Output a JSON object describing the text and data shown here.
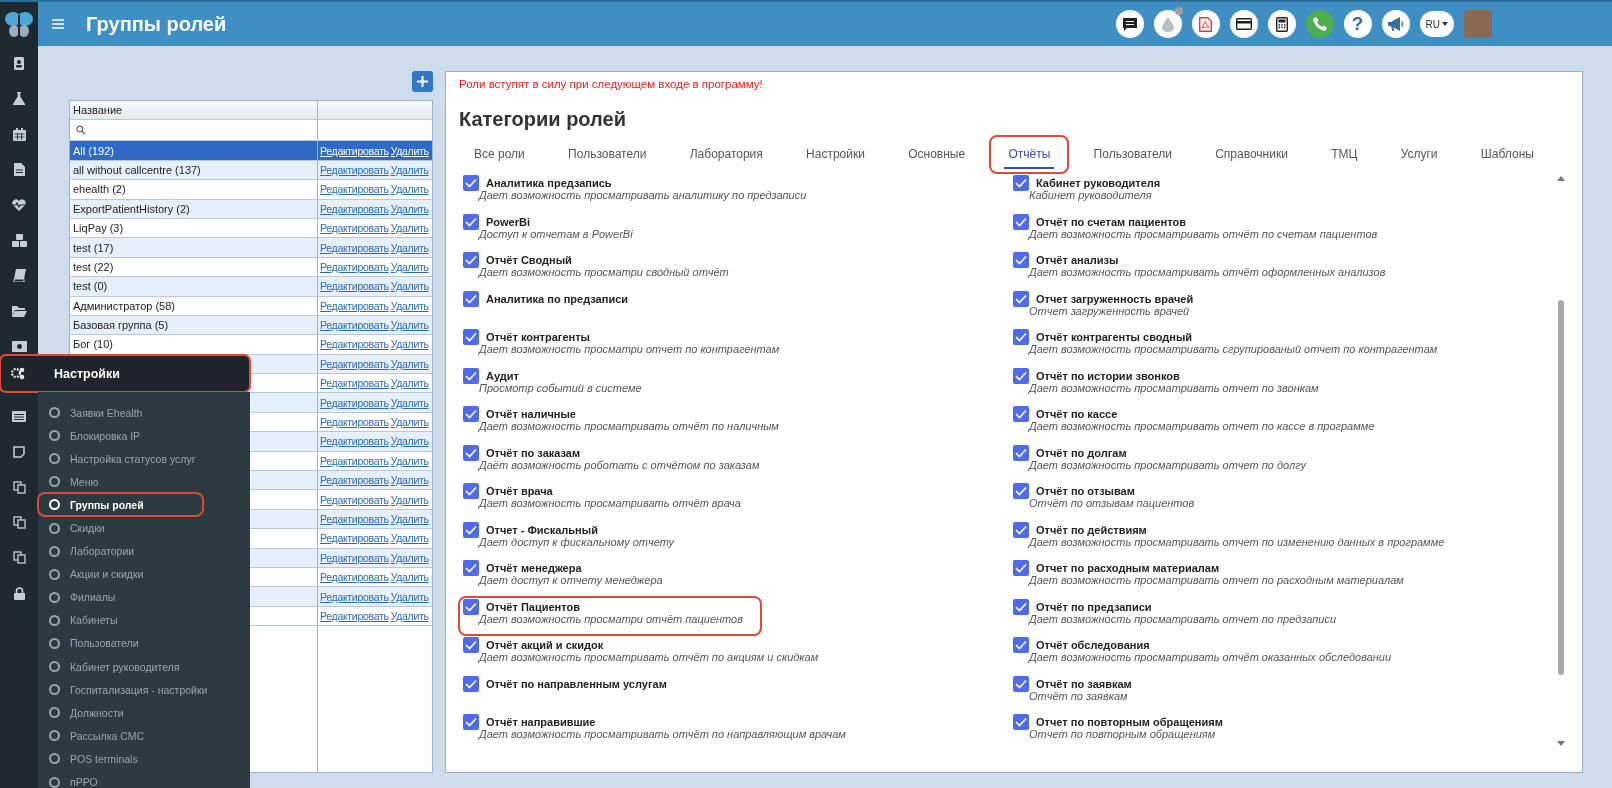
{
  "header": {
    "title": "Группы ролей",
    "help": "?",
    "language": "RU"
  },
  "groups": {
    "column": "Название",
    "rows": [
      {
        "name": "All (192)",
        "selected": true,
        "edit": "Редактировать",
        "delete": "Удалить"
      },
      {
        "name": "all without callcentre (137)",
        "selected": false,
        "edit": "Редактировать",
        "delete": "Удалить"
      },
      {
        "name": "ehealth (2)",
        "selected": false,
        "edit": "Редактировать",
        "delete": "Удалить"
      },
      {
        "name": "ExportPatientHistory (2)",
        "selected": false,
        "edit": "Редактировать",
        "delete": "Удалить"
      },
      {
        "name": "LiqPay (3)",
        "selected": false,
        "edit": "Редактировать",
        "delete": "Удалить"
      },
      {
        "name": "test (17)",
        "selected": false,
        "edit": "Редактировать",
        "delete": "Удалить"
      },
      {
        "name": "test (22)",
        "selected": false,
        "edit": "Редактировать",
        "delete": "Удалить"
      },
      {
        "name": "test (0)",
        "selected": false,
        "edit": "Редактировать",
        "delete": "Удалить"
      },
      {
        "name": "Администратор (58)",
        "selected": false,
        "edit": "Редактировать",
        "delete": "Удалить"
      },
      {
        "name": "Базовая группа (5)",
        "selected": false,
        "edit": "Редактировать",
        "delete": "Удалить"
      },
      {
        "name": "Бог (10)",
        "selected": false,
        "edit": "Редактировать",
        "delete": "Удалить"
      },
      {
        "selected": false,
        "edit": "Редактировать",
        "delete": "Удалить"
      },
      {
        "selected": false,
        "edit": "Редактировать",
        "delete": "Удалить"
      },
      {
        "selected": false,
        "edit": "Редактировать",
        "delete": "Удалить"
      },
      {
        "selected": false,
        "edit": "Редактировать",
        "delete": "Удалить"
      },
      {
        "selected": false,
        "edit": "Редактировать",
        "delete": "Удалить"
      },
      {
        "selected": false,
        "edit": "Редактировать",
        "delete": "Удалить"
      },
      {
        "selected": false,
        "edit": "Редактировать",
        "delete": "Удалить"
      },
      {
        "selected": false,
        "edit": "Редактировать",
        "delete": "Удалить"
      },
      {
        "selected": false,
        "edit": "Редактировать",
        "delete": "Удалить"
      },
      {
        "selected": false,
        "edit": "Редактировать",
        "delete": "Удалить"
      },
      {
        "selected": false,
        "edit": "Редактировать",
        "delete": "Удалить"
      },
      {
        "selected": false,
        "edit": "Редактировать",
        "delete": "Удалить"
      },
      {
        "selected": false,
        "edit": "Редактировать",
        "delete": "Удалить"
      },
      {
        "selected": false,
        "edit": "Редактировать",
        "delete": "Удалить"
      }
    ]
  },
  "menu": {
    "section": {
      "label": "Настройки",
      "highlighted": true
    },
    "items": [
      {
        "label": "Заявки Ehealth",
        "selected": false,
        "highlighted": false
      },
      {
        "label": "Блокировка IP",
        "selected": false,
        "highlighted": false
      },
      {
        "label": "Настройка статусов услуг",
        "selected": false,
        "highlighted": false
      },
      {
        "label": "Меню",
        "selected": false,
        "highlighted": false
      },
      {
        "label": "Группы ролей",
        "selected": true,
        "highlighted": true
      },
      {
        "label": "Скидки",
        "selected": false,
        "highlighted": false
      },
      {
        "label": "Лаборатории",
        "selected": false,
        "highlighted": false
      },
      {
        "label": "Акции и скидки",
        "selected": false,
        "highlighted": false
      },
      {
        "label": "Филиалы",
        "selected": false,
        "highlighted": false
      },
      {
        "label": "Кабинеты",
        "selected": false,
        "highlighted": false
      },
      {
        "label": "Пользователи",
        "selected": false,
        "highlighted": false
      },
      {
        "label": "Кабинет руководителя",
        "selected": false,
        "highlighted": false
      },
      {
        "label": "Госпитализация - настройки",
        "selected": false,
        "highlighted": false
      },
      {
        "label": "Должности",
        "selected": false,
        "highlighted": false
      },
      {
        "label": "Рассылка СМС",
        "selected": false,
        "highlighted": false
      },
      {
        "label": "POS terminals",
        "selected": false,
        "highlighted": false
      },
      {
        "label": "пРРО",
        "selected": false,
        "highlighted": false
      }
    ]
  },
  "panel": {
    "notice": "Роли вступят в силу при следующем входе в программу!",
    "title": "Категории ролей",
    "tabs": [
      {
        "label": "Все роли",
        "selected": false,
        "highlighted": false
      },
      {
        "label": "Пользователи",
        "selected": false,
        "highlighted": false
      },
      {
        "label": "Лаборатория",
        "selected": false,
        "highlighted": false
      },
      {
        "label": "Настройки",
        "selected": false,
        "highlighted": false
      },
      {
        "label": "Основные",
        "selected": false,
        "highlighted": false
      },
      {
        "label": "Отчёты",
        "selected": true,
        "highlighted": true
      },
      {
        "label": "Пользователи",
        "selected": false,
        "highlighted": false
      },
      {
        "label": "Справочники",
        "selected": false,
        "highlighted": false
      },
      {
        "label": "ТМЦ",
        "selected": false,
        "highlighted": false
      },
      {
        "label": "Услуги",
        "selected": false,
        "highlighted": false
      },
      {
        "label": "Шаблоны",
        "selected": false,
        "highlighted": false
      }
    ],
    "permissions_left": [
      {
        "title": "Аналитика предзапись",
        "description": "Дает возможность просматривать аналитику по предзаписи",
        "checked": true,
        "highlighted": false
      },
      {
        "title": "PowerBi",
        "description": "Доступ к отчетам в PowerBi",
        "checked": true,
        "highlighted": false
      },
      {
        "title": "Отчёт Сводный",
        "description": "Дает возможность просматри сводный отчёт",
        "checked": true,
        "highlighted": false
      },
      {
        "title": "Аналитика по предзаписи",
        "checked": true,
        "highlighted": false
      },
      {
        "title": "Отчёт контрагенты",
        "description": "Дает возможность просматри отчет по контрагентам",
        "checked": true,
        "highlighted": false
      },
      {
        "title": "Аудит",
        "description": "Просмотр событий в системе",
        "checked": true,
        "highlighted": false
      },
      {
        "title": "Отчёт наличные",
        "description": "Дает возможность просматривать отчёт по наличным",
        "checked": true,
        "highlighted": false
      },
      {
        "title": "Отчёт по заказам",
        "description": "Даёт возможность роботать с отчётом по заказам",
        "checked": true,
        "highlighted": false
      },
      {
        "title": "Отчёт врача",
        "description": "Дает возможность просматривать отчёт врача",
        "checked": true,
        "highlighted": false
      },
      {
        "title": "Отчет - Фискальный",
        "description": "Дает доступ к фискальному отчету",
        "checked": true,
        "highlighted": false
      },
      {
        "title": "Отчёт менеджера",
        "description": "Дает доступ к отчету менеджера",
        "checked": true,
        "highlighted": false
      },
      {
        "title": "Отчёт Пациентов",
        "description": "Дает возможность просматри отчёт пациентов",
        "checked": true,
        "highlighted": true
      },
      {
        "title": "Отчёт акций и скидок",
        "description": "Дает возможность просматривать отчёт по акциям и скидкам",
        "checked": true,
        "highlighted": false
      },
      {
        "title": "Отчёт по направленным услугам",
        "checked": true,
        "highlighted": false
      },
      {
        "title": "Отчёт направившие",
        "description": "Дает возможность просматривать отчёт по направляющим врачам",
        "checked": true,
        "highlighted": false
      }
    ],
    "permissions_right": [
      {
        "title": "Кабинет руководителя",
        "description": "Кабинет руководителя",
        "checked": true,
        "highlighted": false
      },
      {
        "title": "Отчёт по счетам пациентов",
        "description": "Дает возможность просматривать отчёт по счетам пациентов",
        "checked": true,
        "highlighted": false
      },
      {
        "title": "Отчёт анализы",
        "description": "Дает возможность просматривать отчёт оформленных анализов",
        "checked": true,
        "highlighted": false
      },
      {
        "title": "Отчет загруженность врачей",
        "description": "Отчет загруженность врачей",
        "checked": true,
        "highlighted": false
      },
      {
        "title": "Отчёт контрагенты сводный",
        "description": "Дает возможность просматривать сгрупированый отчет по контрагентам",
        "checked": true,
        "highlighted": false
      },
      {
        "title": "Отчёт по истории звонков",
        "description": "Дает возможность просматривать отчет по звонкам",
        "checked": true,
        "highlighted": false
      },
      {
        "title": "Отчёт по кассе",
        "description": "Дает возможность просматривать отчет по кассе в программе",
        "checked": true,
        "highlighted": false
      },
      {
        "title": "Отчёт по долгам",
        "description": "Дает возможность просматривать отчет по долгу",
        "checked": true,
        "highlighted": false
      },
      {
        "title": "Отчёт по отзывам",
        "description": "Отчёт по отзывам пациентов",
        "checked": true,
        "highlighted": false
      },
      {
        "title": "Отчёт по действиям",
        "description": "Дает возможность просматривать отчет по изменению данных в программе",
        "checked": true,
        "highlighted": false
      },
      {
        "title": "Отчет по расходным материалам",
        "description": "Дает возможность просматривать отчет по расходным материалам",
        "checked": true,
        "highlighted": false
      },
      {
        "title": "Отчёт по предзаписи",
        "description": "Дает возможность просматривать отчет по предзаписи",
        "checked": true,
        "highlighted": false
      },
      {
        "title": "Отчёт обследования",
        "description": "Дает возможность просматривать отчёт оказанных обследовании",
        "checked": true,
        "highlighted": false
      },
      {
        "title": "Отчёт по заявкам",
        "description": "Отчёт по заявкам",
        "checked": true,
        "highlighted": false
      },
      {
        "title": "Отчет по повторным обращениям",
        "description": "Отчет по повторным обращениям",
        "checked": true,
        "highlighted": false
      }
    ]
  }
}
